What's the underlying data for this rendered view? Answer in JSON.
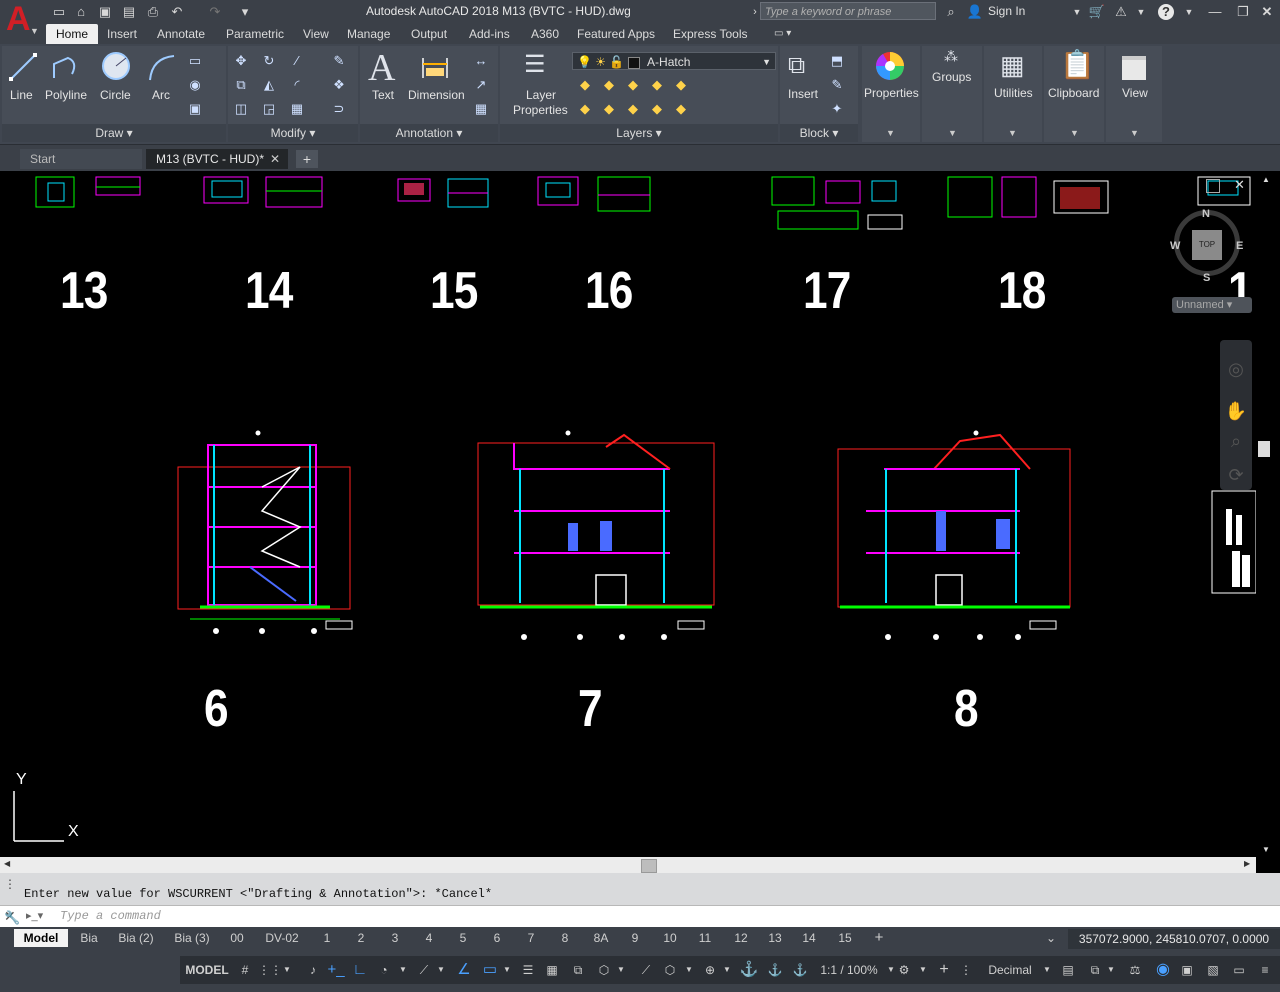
{
  "title_bar": {
    "title": "Autodesk AutoCAD 2018    M13 (BVTC - HUD).dwg",
    "search_placeholder": "Type a keyword or phrase",
    "sign_in": "Sign In"
  },
  "ribbon_tabs": [
    "Home",
    "Insert",
    "Annotate",
    "Parametric",
    "View",
    "Manage",
    "Output",
    "Add-ins",
    "A360",
    "Featured Apps",
    "Express Tools"
  ],
  "ribbon": {
    "draw": {
      "title": "Draw",
      "tools": [
        "Line",
        "Polyline",
        "Circle",
        "Arc"
      ]
    },
    "modify": {
      "title": "Modify"
    },
    "annotation": {
      "title": "Annotation",
      "text": "Text",
      "dimension": "Dimension"
    },
    "layers": {
      "title": "Layers",
      "layer_properties_1": "Layer",
      "layer_properties_2": "Properties",
      "current_layer": "A-Hatch"
    },
    "block": {
      "title": "Block",
      "insert": "Insert"
    },
    "properties": "Properties",
    "groups": "Groups",
    "utilities": "Utilities",
    "clipboard": "Clipboard",
    "view": "View"
  },
  "file_tabs": {
    "start": "Start",
    "current": "M13 (BVTC - HUD)*"
  },
  "canvas": {
    "sheet_numbers_top": [
      "13",
      "14",
      "15",
      "16",
      "17",
      "18",
      "1"
    ],
    "sheet_numbers_bottom": [
      "6",
      "7",
      "8"
    ],
    "viewcube": {
      "top": "TOP",
      "n": "N",
      "s": "S",
      "e": "E",
      "w": "W"
    },
    "wcs": "Unnamed",
    "ucs": {
      "x": "X",
      "y": "Y"
    }
  },
  "command": {
    "history": "Enter new value for WSCURRENT <\"Drafting & Annotation\">: *Cancel*",
    "placeholder": "Type a command"
  },
  "layout_tabs": [
    "Model",
    "Bia",
    "Bia (2)",
    "Bia (3)",
    "00",
    "DV-02",
    "1",
    "2",
    "3",
    "4",
    "5",
    "6",
    "7",
    "8",
    "8A",
    "9",
    "10",
    "11",
    "12",
    "13",
    "14",
    "15"
  ],
  "coordinates": "357072.9000, 245810.0707, 0.0000",
  "status": {
    "model": "MODEL",
    "scale": "1:1 / 100%",
    "units": "Decimal"
  },
  "colors": {
    "chrome": "#3b4048",
    "canvas": "#000000",
    "accent_cyan": "#00e5ff",
    "accent_magenta": "#ff00ff",
    "accent_green": "#00ff00",
    "accent_red": "#ff2020",
    "logo_red": "#d21f26"
  }
}
